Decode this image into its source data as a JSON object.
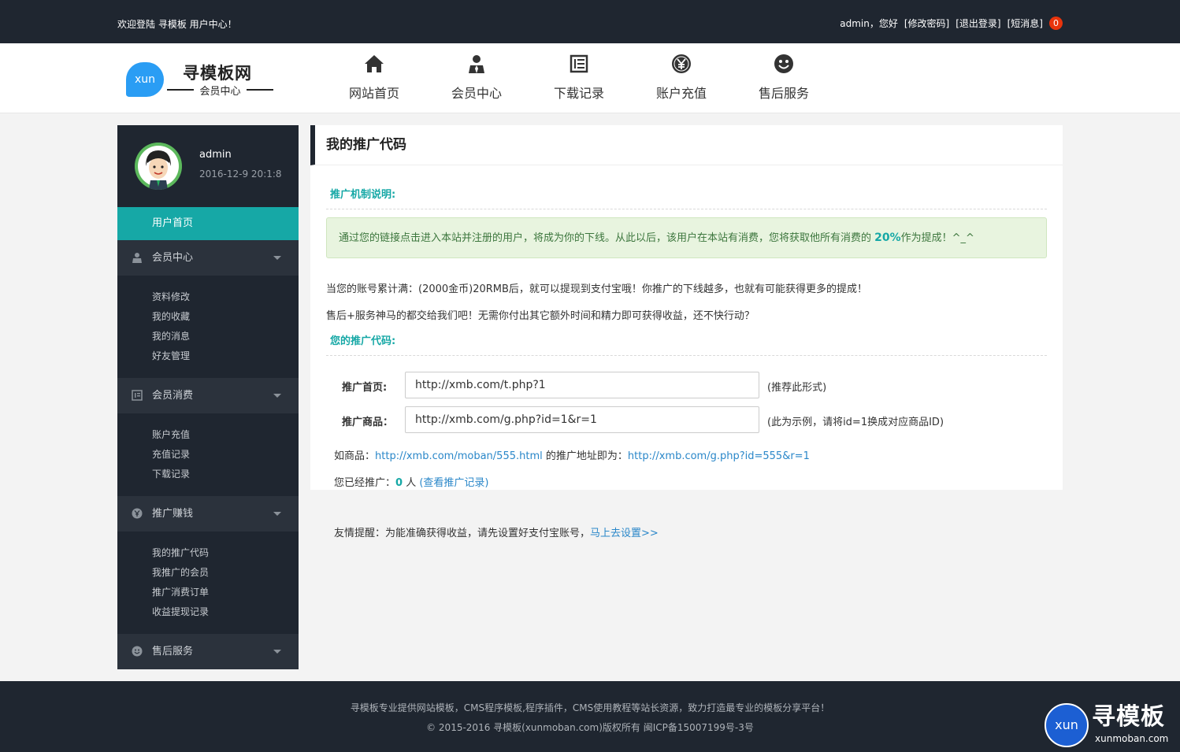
{
  "topbar": {
    "welcome": "欢迎登陆 寻模板 用户中心！",
    "greeting": "admin，您好",
    "change_password": "[修改密码]",
    "logout": "[退出登录]",
    "messages": "[短消息]",
    "message_count": "0"
  },
  "logo": {
    "bubble": "xun",
    "title": "寻模板网",
    "subtitle": "会员中心"
  },
  "nav": {
    "items": [
      {
        "label": "网站首页",
        "icon": "home-icon"
      },
      {
        "label": "会员中心",
        "icon": "user-icon"
      },
      {
        "label": "下载记录",
        "icon": "list-icon"
      },
      {
        "label": "账户充值",
        "icon": "yen-icon"
      },
      {
        "label": "售后服务",
        "icon": "smile-icon"
      }
    ]
  },
  "sidebar": {
    "profile": {
      "name": "admin",
      "date": "2016-12-9 20:1:8"
    },
    "home": "用户首页",
    "groups": [
      {
        "title": "会员中心",
        "icon": "user-icon",
        "items": [
          "资料修改",
          "我的收藏",
          "我的消息",
          "好友管理"
        ]
      },
      {
        "title": "会员消费",
        "icon": "list-icon",
        "items": [
          "账户充值",
          "充值记录",
          "下载记录"
        ]
      },
      {
        "title": "推广赚钱",
        "icon": "yen-icon",
        "items": [
          "我的推广代码",
          "我推广的会员",
          "推广消费订单",
          "收益提现记录"
        ]
      },
      {
        "title": "售后服务",
        "icon": "smile-icon",
        "items": []
      }
    ]
  },
  "main": {
    "title": "我的推广代码",
    "mechanism_title": "推广机制说明:",
    "notice_before": "通过您的链接点击进入本站并注册的用户，将成为你的下线。从此以后，该用户在本站有消费，您将获取他所有消费的 ",
    "notice_percent": "20%",
    "notice_after": "作为提成！^_^",
    "para1": "当您的账号累计满：(2000金币)20RMB后，就可以提现到支付宝哦！你推广的下线越多，也就有可能获得更多的提成！",
    "para2": "售后+服务神马的都交给我们吧！无需你付出其它额外时间和精力即可获得收益，还不快行动？",
    "code_title": "您的推广代码:",
    "home_label": "推广首页:",
    "home_url": "http://xmb.com/t.php?1",
    "home_hint": "(推荐此形式)",
    "goods_label": "推广商品：",
    "goods_url": "http://xmb.com/g.php?id=1&r=1",
    "goods_hint": "(此为示例，请将id=1换成对应商品ID)",
    "example_prefix": "如商品：",
    "example_link1": "http://xmb.com/moban/555.html",
    "example_middle": " 的推广地址即为：",
    "example_link2": "http://xmb.com/g.php?id=555&r=1",
    "promoted_prefix": "您已经推广：",
    "promoted_count": "0",
    "promoted_unit": " 人 ",
    "promoted_link": "(查看推广记录)"
  },
  "reminder": {
    "text": "友情提醒：为能准确获得收益，请先设置好支付宝账号，",
    "link": "马上去设置>>"
  },
  "footer": {
    "line1": "寻模板专业提供网站模板，CMS程序模板,程序插件，CMS使用教程等站长资源，致力打造最专业的模板分享平台！",
    "line2": "© 2015-2016 寻模板(xunmoban.com)版权所有   闽ICP备15007199号-3号",
    "logo_circle": "xun",
    "logo_title": "寻模板",
    "logo_sub": "xunmoban.com"
  },
  "colors": {
    "dark": "#1f2630",
    "teal": "#16a8a6",
    "link": "#2a87c9",
    "badge": "#e8340c"
  }
}
